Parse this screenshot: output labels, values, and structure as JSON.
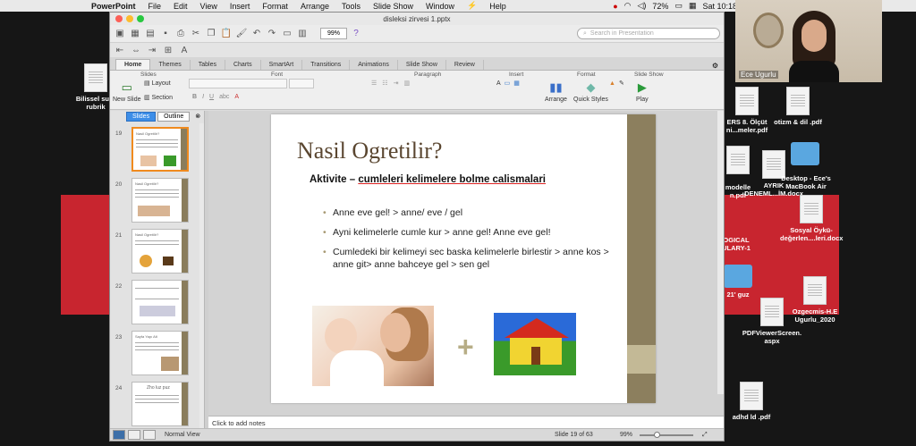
{
  "menubar": {
    "app": "PowerPoint",
    "items": [
      "File",
      "Edit",
      "View",
      "Insert",
      "Format",
      "Arrange",
      "Tools",
      "Slide Show",
      "Window",
      "Help"
    ],
    "battery": "72%",
    "clock": "Sat 10:18"
  },
  "webcam": {
    "name": "Ece Ugurlu"
  },
  "desktop_left": [
    {
      "badge": "DOCX",
      "label": "Bilissel sure\nrubrik"
    }
  ],
  "desktop_right": [
    {
      "label": "ERS 8. Ölçüt\nni...meler.pdf",
      "kind": "doc"
    },
    {
      "label": "otizm & dil .pdf",
      "kind": "doc"
    },
    {
      "label": "",
      "kind": "doc"
    },
    {
      "label": "",
      "kind": "folder"
    },
    {
      "label": "modelle\nn.pdf",
      "kind": "doc"
    },
    {
      "badge": "DOCX",
      "label": "AYRIK\nDENEML...İM.docx",
      "kind": "doc"
    },
    {
      "label": "Desktop - Ece's\nMacBook Air",
      "kind": "folder"
    },
    {
      "badge": "DOCX",
      "label": "Sosyal Öykü-\ndeğerlen....leri.docx",
      "kind": "doc"
    },
    {
      "label": "OGICAL\nULARY-1",
      "kind": "doc"
    },
    {
      "label": "21' guz",
      "kind": "folder"
    },
    {
      "label": "Ozgecmis-H.E\nUgurlu_2020",
      "kind": "doc"
    },
    {
      "label": "PDFViewerScreen.\naspx",
      "kind": "doc"
    },
    {
      "label": "adhd ld .pdf",
      "kind": "doc"
    }
  ],
  "window": {
    "title": "disleksi zirvesi 1.pptx",
    "zoom": "99%",
    "search_placeholder": "Search in Presentation",
    "ribbon_tabs": [
      "Home",
      "Themes",
      "Tables",
      "Charts",
      "SmartArt",
      "Transitions",
      "Animations",
      "Slide Show",
      "Review"
    ],
    "ribbon_groups": {
      "slides": "Slides",
      "font": "Font",
      "paragraph": "Paragraph",
      "insert": "Insert",
      "format": "Format",
      "slideshow": "Slide Show"
    },
    "ribbon_buttons": {
      "new_slide": "New Slide",
      "layout": "Layout",
      "section": "Section",
      "arrange": "Arrange",
      "quick_styles": "Quick Styles",
      "play": "Play"
    },
    "panel_tabs": [
      "Slides",
      "Outline"
    ],
    "thumbnails": [
      {
        "num": "19",
        "title": "Nasil Ogretilir?",
        "selected": true
      },
      {
        "num": "20",
        "title": "Nasil Ogretilir?",
        "selected": false
      },
      {
        "num": "21",
        "title": "Nasil Ogretilir?",
        "selected": false
      },
      {
        "num": "22",
        "title": "",
        "selected": false
      },
      {
        "num": "23",
        "title": "Sayfa Yapı Alt",
        "selected": false
      },
      {
        "num": "24",
        "title": "Zho luz puz",
        "selected": false
      }
    ],
    "slide": {
      "title": "Nasil Ogretilir?",
      "subtitle_prefix": "Aktivite – ",
      "subtitle_underlined": "cumleleri kelimelere bolme calismalari",
      "bullets": [
        "Anne eve gel! > anne/ eve / gel",
        "Ayni kelimelerle cumle kur > anne gel! Anne eve gel!",
        "Cumledeki bir kelimeyi sec baska kelimelerle birlestir > anne kos > anne git> anne bahceye gel > sen gel"
      ],
      "plus_sign": "+"
    },
    "notes_placeholder": "Click to add notes",
    "status": {
      "view": "Normal View",
      "slide_counter": "Slide 19 of 63",
      "zoom": "99%"
    }
  },
  "colors": {
    "accent_red": "#c8252f",
    "selection_orange": "#f08a1e",
    "slide_bar": "#8c7f5e",
    "title_brown": "#5a4630"
  }
}
